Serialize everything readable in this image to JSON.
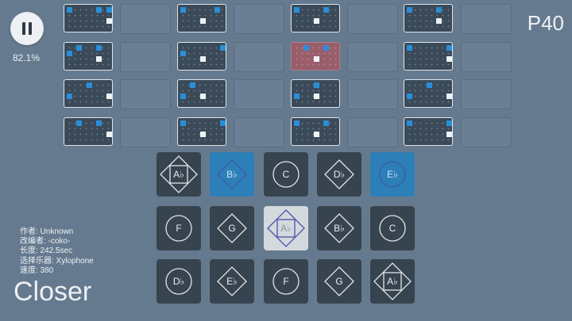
{
  "pause_icon": "pause-icon",
  "progress_text": "82.1%",
  "page_label": "P40",
  "sheet": {
    "rows": [
      [
        {
          "filled": true,
          "current": false,
          "notes": [
            {
              "c": 0,
              "r": 0,
              "t": "blue"
            },
            {
              "c": 6,
              "r": 0,
              "t": "blue"
            },
            {
              "c": 8,
              "r": 0,
              "t": "blue"
            },
            {
              "c": 8,
              "r": 2,
              "t": "white"
            }
          ]
        },
        {
          "filled": false
        },
        {
          "filled": true,
          "current": false,
          "notes": [
            {
              "c": 0,
              "r": 0,
              "t": "blue"
            },
            {
              "c": 7,
              "r": 0,
              "t": "blue"
            },
            {
              "c": 4,
              "r": 2,
              "t": "white"
            }
          ]
        },
        {
          "filled": false
        },
        {
          "filled": true,
          "current": false,
          "notes": [
            {
              "c": 0,
              "r": 0,
              "t": "blue"
            },
            {
              "c": 6,
              "r": 0,
              "t": "blue"
            },
            {
              "c": 4,
              "r": 2,
              "t": "white"
            }
          ]
        },
        {
          "filled": false
        },
        {
          "filled": true,
          "current": false,
          "notes": [
            {
              "c": 0,
              "r": 0,
              "t": "blue"
            },
            {
              "c": 6,
              "r": 0,
              "t": "blue"
            },
            {
              "c": 6,
              "r": 2,
              "t": "white"
            }
          ]
        },
        {
          "filled": false
        }
      ],
      [
        {
          "filled": true,
          "current": false,
          "notes": [
            {
              "c": 0,
              "r": 1,
              "t": "blue"
            },
            {
              "c": 2,
              "r": 0,
              "t": "blue"
            },
            {
              "c": 6,
              "r": 0,
              "t": "blue"
            },
            {
              "c": 6,
              "r": 2,
              "t": "white"
            }
          ]
        },
        {
          "filled": false
        },
        {
          "filled": true,
          "current": false,
          "notes": [
            {
              "c": 0,
              "r": 1,
              "t": "blue"
            },
            {
              "c": 8,
              "r": 0,
              "t": "blue"
            },
            {
              "c": 4,
              "r": 2,
              "t": "white"
            }
          ]
        },
        {
          "filled": false
        },
        {
          "filled": true,
          "current": true,
          "notes": [
            {
              "c": 2,
              "r": 0,
              "t": "blue"
            },
            {
              "c": 6,
              "r": 0,
              "t": "blue"
            },
            {
              "c": 4,
              "r": 2,
              "t": "white"
            }
          ]
        },
        {
          "filled": false
        },
        {
          "filled": true,
          "current": false,
          "notes": [
            {
              "c": 0,
              "r": 0,
              "t": "blue"
            },
            {
              "c": 8,
              "r": 0,
              "t": "blue"
            },
            {
              "c": 8,
              "r": 2,
              "t": "white"
            }
          ]
        },
        {
          "filled": false
        }
      ],
      [
        {
          "filled": true,
          "current": false,
          "notes": [
            {
              "c": 0,
              "r": 2,
              "t": "blue"
            },
            {
              "c": 4,
              "r": 0,
              "t": "blue"
            },
            {
              "c": 8,
              "r": 2,
              "t": "white"
            }
          ]
        },
        {
          "filled": false
        },
        {
          "filled": true,
          "current": false,
          "notes": [
            {
              "c": 0,
              "r": 2,
              "t": "blue"
            },
            {
              "c": 2,
              "r": 0,
              "t": "blue"
            },
            {
              "c": 4,
              "r": 2,
              "t": "white"
            }
          ]
        },
        {
          "filled": false
        },
        {
          "filled": true,
          "current": false,
          "notes": [
            {
              "c": 0,
              "r": 2,
              "t": "blue"
            },
            {
              "c": 4,
              "r": 0,
              "t": "blue"
            },
            {
              "c": 4,
              "r": 2,
              "t": "white"
            }
          ]
        },
        {
          "filled": false
        },
        {
          "filled": true,
          "current": false,
          "notes": [
            {
              "c": 0,
              "r": 2,
              "t": "blue"
            },
            {
              "c": 4,
              "r": 0,
              "t": "blue"
            },
            {
              "c": 8,
              "r": 2,
              "t": "white"
            }
          ]
        },
        {
          "filled": false
        }
      ],
      [
        {
          "filled": true,
          "current": false,
          "notes": [
            {
              "c": 2,
              "r": 0,
              "t": "blue"
            },
            {
              "c": 6,
              "r": 0,
              "t": "blue"
            },
            {
              "c": 8,
              "r": 2,
              "t": "white"
            }
          ]
        },
        {
          "filled": false
        },
        {
          "filled": true,
          "current": false,
          "notes": [
            {
              "c": 0,
              "r": 0,
              "t": "blue"
            },
            {
              "c": 8,
              "r": 0,
              "t": "blue"
            },
            {
              "c": 4,
              "r": 2,
              "t": "white"
            }
          ]
        },
        {
          "filled": false
        },
        {
          "filled": true,
          "current": false,
          "notes": [
            {
              "c": 0,
              "r": 0,
              "t": "blue"
            },
            {
              "c": 6,
              "r": 0,
              "t": "blue"
            },
            {
              "c": 4,
              "r": 2,
              "t": "white"
            }
          ]
        },
        {
          "filled": false
        },
        {
          "filled": true,
          "current": false,
          "notes": [
            {
              "c": 0,
              "r": 0,
              "t": "blue"
            },
            {
              "c": 8,
              "r": 0,
              "t": "blue"
            },
            {
              "c": 8,
              "r": 2,
              "t": "white"
            }
          ]
        },
        {
          "filled": false
        }
      ]
    ]
  },
  "keyboard": {
    "rows": [
      [
        {
          "note": "A♭",
          "shape": "diamond-square",
          "state": "normal"
        },
        {
          "note": "B♭",
          "shape": "diamond",
          "state": "blue"
        },
        {
          "note": "C",
          "shape": "circle",
          "state": "normal"
        },
        {
          "note": "D♭",
          "shape": "diamond",
          "state": "normal"
        },
        {
          "note": "E♭",
          "shape": "circle",
          "state": "blue"
        }
      ],
      [
        {
          "note": "F",
          "shape": "circle",
          "state": "normal"
        },
        {
          "note": "G",
          "shape": "diamond",
          "state": "normal"
        },
        {
          "note": "A♭",
          "shape": "diamond-square",
          "state": "pressed"
        },
        {
          "note": "B♭",
          "shape": "diamond",
          "state": "normal"
        },
        {
          "note": "C",
          "shape": "circle",
          "state": "normal"
        }
      ],
      [
        {
          "note": "D♭",
          "shape": "circle",
          "state": "normal"
        },
        {
          "note": "E♭",
          "shape": "diamond",
          "state": "normal"
        },
        {
          "note": "F",
          "shape": "circle",
          "state": "normal"
        },
        {
          "note": "G",
          "shape": "diamond",
          "state": "normal"
        },
        {
          "note": "A♭",
          "shape": "diamond-square",
          "state": "normal"
        }
      ]
    ]
  },
  "info": {
    "author": "作者: Unknown",
    "arranger": "改编者: -coko-",
    "length": "长度: 242.5sec",
    "instrument": "选择乐器: Xylophone",
    "speed": "速度: 380"
  },
  "song_title": "Closer",
  "colors": {
    "background": "#657a8f",
    "key": "#37444f",
    "key_active": "#2d7fb8",
    "key_pressed": "#d4d9de",
    "note_blue": "#2a8fd8",
    "current_cell": "#9a5e6a"
  }
}
